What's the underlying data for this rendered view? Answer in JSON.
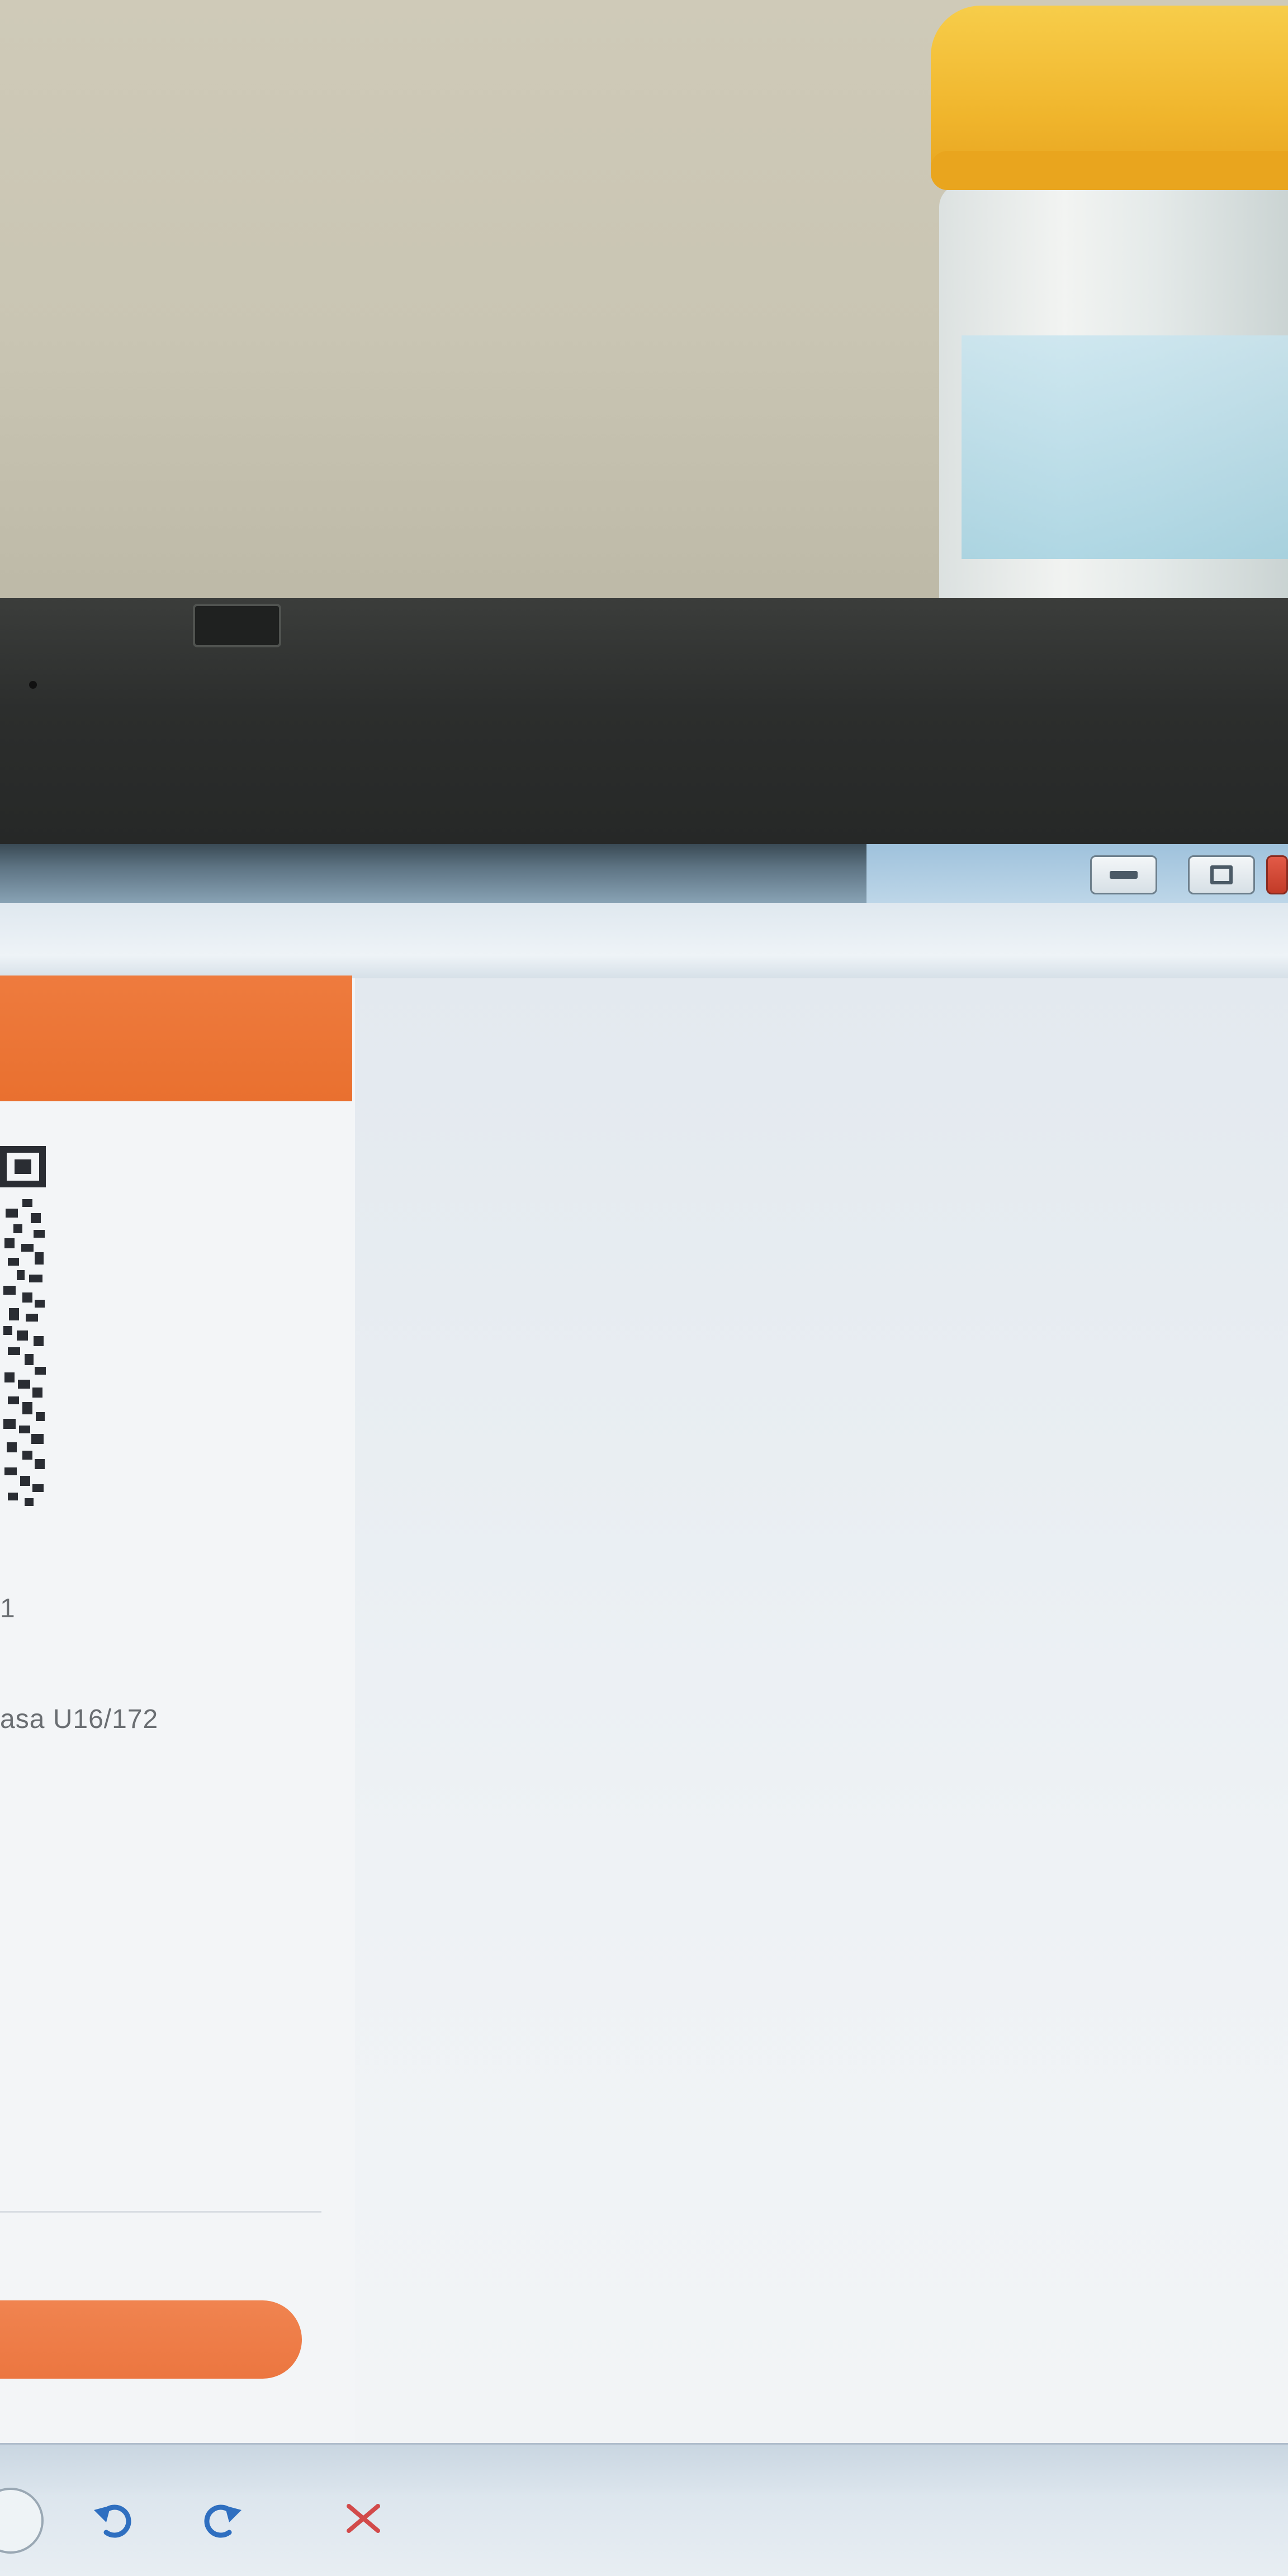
{
  "window": {
    "controls": {
      "minimize": "minimize",
      "maximize": "maximize",
      "close": "close"
    }
  },
  "page": {
    "header_color": "#e9702f",
    "info_lines": [
      "1",
      "asa U16/172"
    ],
    "primary_button_color": "#ec7640"
  },
  "bottom_bar": {
    "icons": [
      "home-icon",
      "undo-icon",
      "redo-icon",
      "close-x-icon"
    ],
    "accent": "#2f6fc0",
    "cancel_color": "#d24a4a"
  }
}
